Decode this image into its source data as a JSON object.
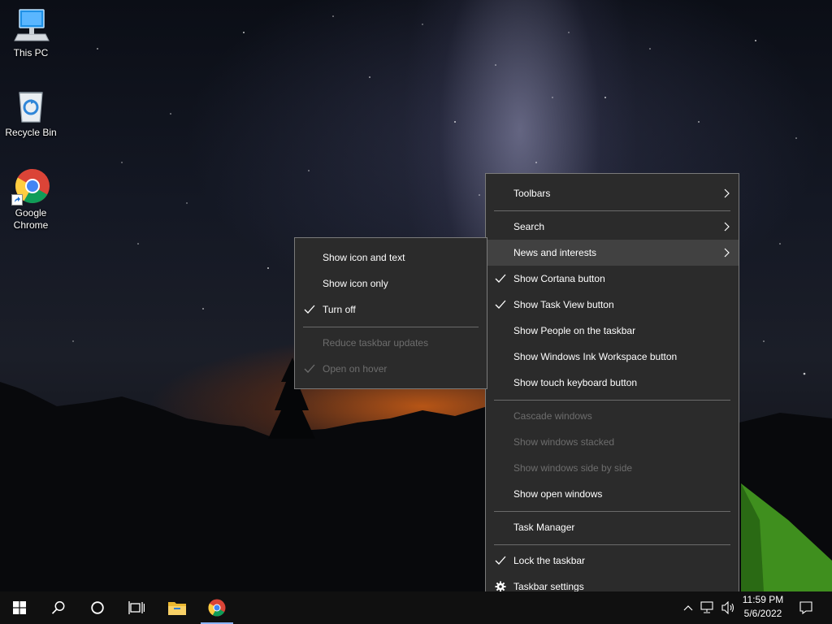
{
  "desktop": {
    "icons": [
      {
        "label": "This PC",
        "icon": "monitor-icon"
      },
      {
        "label": "Recycle Bin",
        "icon": "recycle-bin-icon"
      },
      {
        "label_line1": "Google",
        "label_line2": "Chrome",
        "icon": "chrome-icon"
      }
    ]
  },
  "taskbar_menu": {
    "items": [
      {
        "label": "Toolbars",
        "submenu": true
      },
      {
        "label": "Search",
        "submenu": true
      },
      {
        "label": "News and interests",
        "submenu": true,
        "highlighted": true
      },
      {
        "label": "Show Cortana button",
        "checked": true
      },
      {
        "label": "Show Task View button",
        "checked": true
      },
      {
        "label": "Show People on the taskbar"
      },
      {
        "label": "Show Windows Ink Workspace button"
      },
      {
        "label": "Show touch keyboard button"
      },
      {
        "label": "Cascade windows",
        "disabled": true
      },
      {
        "label": "Show windows stacked",
        "disabled": true
      },
      {
        "label": "Show windows side by side",
        "disabled": true
      },
      {
        "label": "Show open windows"
      },
      {
        "label": "Task Manager"
      },
      {
        "label": "Lock the taskbar",
        "checked": true
      },
      {
        "label": "Taskbar settings",
        "icon": "gear-icon"
      }
    ]
  },
  "news_submenu": {
    "items": [
      {
        "label": "Show icon and text"
      },
      {
        "label": "Show icon only"
      },
      {
        "label": "Turn off",
        "checked": true
      },
      {
        "label": "Reduce taskbar updates",
        "disabled": true
      },
      {
        "label": "Open on hover",
        "checked": true,
        "disabled": true
      }
    ]
  },
  "taskbar": {
    "buttons": [
      "start-icon",
      "search-icon",
      "cortana-icon",
      "task-view-icon",
      "file-explorer-icon",
      "chrome-icon"
    ],
    "tray_icons": [
      "chevron-up-icon",
      "network-icon",
      "volume-icon",
      "notification-icon"
    ],
    "time": "11:59 PM",
    "date": "5/6/2022"
  },
  "colors": {
    "menu_bg": "#2b2b2b",
    "menu_hover": "#414141",
    "menu_disabled_text": "#6d6d6d",
    "taskbar_bg": "#101010"
  }
}
